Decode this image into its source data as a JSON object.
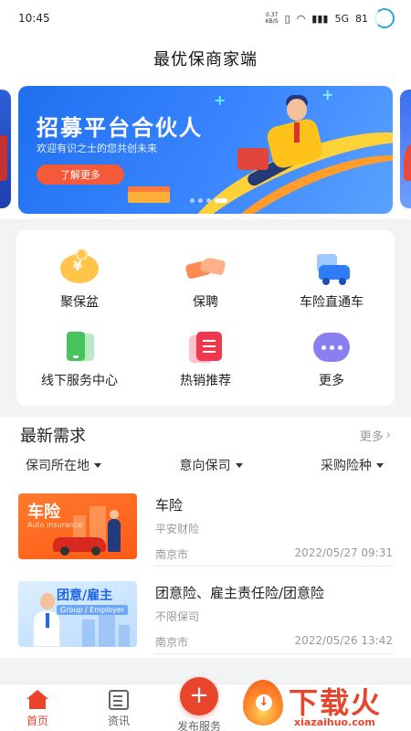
{
  "status_bar": {
    "time": "10:45",
    "net_speed": "0.37",
    "net_unit": "KB/S",
    "signal": "5G",
    "battery": "81"
  },
  "header": {
    "title": "最优保商家端"
  },
  "banner": {
    "headline": "招募平台合伙人",
    "subtitle": "欢迎有识之士的您共创未来",
    "button_label": "了解更多"
  },
  "grid": {
    "items": [
      {
        "label": "聚保盆",
        "icon": "piggy-bank-icon"
      },
      {
        "label": "保聘",
        "icon": "handshake-icon"
      },
      {
        "label": "车险直通车",
        "icon": "car-insurance-icon"
      },
      {
        "label": "线下服务中心",
        "icon": "phone-icon"
      },
      {
        "label": "热销推荐",
        "icon": "list-icon"
      },
      {
        "label": "更多",
        "icon": "more-icon"
      }
    ]
  },
  "demand": {
    "title": "最新需求",
    "more_label": "更多",
    "filters": [
      "保司所在地",
      "意向保司",
      "采购险种"
    ],
    "items": [
      {
        "thumb_title": "车险",
        "thumb_subtitle": "Auto insurance",
        "title": "车险",
        "company": "平安财险",
        "city": "南京市",
        "date": "2022/05/27 09:31"
      },
      {
        "thumb_title": "团意/雇主",
        "thumb_subtitle": "Group / Employer",
        "title": "团意险、雇主责任险/团意险",
        "company": "不限保司",
        "city": "南京市",
        "date": "2022/05/26 13:42"
      }
    ]
  },
  "bottom_nav": {
    "home": "首页",
    "news": "资讯",
    "publish": "发布服务"
  },
  "watermark": {
    "text": "下载火",
    "url": "xiazaihuo.com"
  },
  "colors": {
    "accent": "#e8452c",
    "banner_blue": "#1f6ff0"
  }
}
